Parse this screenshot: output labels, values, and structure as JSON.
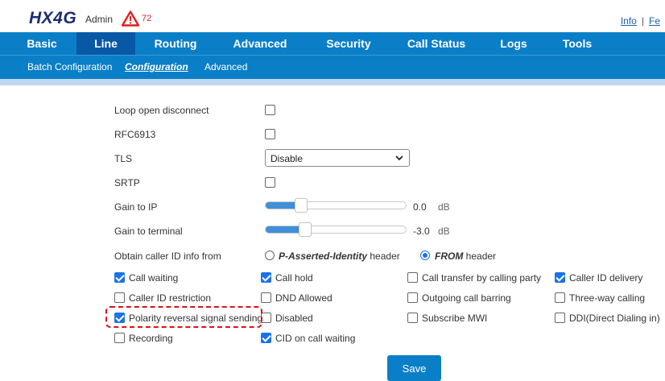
{
  "header": {
    "logo": "HX4G",
    "user": "Admin",
    "alert_count": "72",
    "links": [
      "Info",
      "Fe"
    ]
  },
  "main_tabs": [
    {
      "label": "Basic"
    },
    {
      "label": "Line",
      "active": true
    },
    {
      "label": "Routing"
    },
    {
      "label": "Advanced"
    },
    {
      "label": "Security"
    },
    {
      "label": "Call Status"
    },
    {
      "label": "Logs"
    },
    {
      "label": "Tools"
    }
  ],
  "sub_tabs": [
    {
      "label": "Batch Configuration"
    },
    {
      "label": "Configuration",
      "active": true
    },
    {
      "label": "Advanced"
    }
  ],
  "settings": {
    "loop_open": {
      "label": "Loop open disconnect",
      "checked": false
    },
    "rfc6913": {
      "label": "RFC6913",
      "checked": false
    },
    "tls": {
      "label": "TLS",
      "value": "Disable"
    },
    "srtp": {
      "label": "SRTP",
      "checked": false
    },
    "gain_ip": {
      "label": "Gain to IP",
      "value": "0.0",
      "unit": "dB",
      "level_fraction": 0.25
    },
    "gain_terminal": {
      "label": "Gain to terminal",
      "value": "-3.0",
      "unit": "dB",
      "level_fraction": 0.28
    },
    "caller_id_source": {
      "label": "Obtain caller ID info from",
      "options": [
        {
          "name": "P-Asserted-Identity",
          "suffix": "header",
          "selected": false
        },
        {
          "name": "FROM",
          "suffix": "header",
          "selected": true
        }
      ]
    }
  },
  "features": [
    {
      "label": "Call waiting",
      "checked": true
    },
    {
      "label": "Call hold",
      "checked": true
    },
    {
      "label": "Call transfer by calling party",
      "checked": false
    },
    {
      "label": "Caller ID delivery",
      "checked": true
    },
    {
      "label": "Caller ID restriction",
      "checked": false
    },
    {
      "label": "DND Allowed",
      "checked": false
    },
    {
      "label": "Outgoing call barring",
      "checked": false
    },
    {
      "label": "Three-way calling",
      "checked": false
    },
    {
      "label": "Polarity reversal signal sending",
      "checked": true
    },
    {
      "label": "Disabled",
      "checked": false
    },
    {
      "label": "Subscribe MWI",
      "checked": false
    },
    {
      "label": "DDI(Direct Dialing in)",
      "checked": false
    },
    {
      "label": "Recording",
      "checked": false
    },
    {
      "label": "CID on call waiting",
      "checked": true
    }
  ],
  "save_label": "Save",
  "colors": {
    "nav_blue": "#0a7fc8",
    "nav_active": "#0858a6",
    "check_blue": "#1a73e8",
    "highlight_red": "#d7141a"
  }
}
